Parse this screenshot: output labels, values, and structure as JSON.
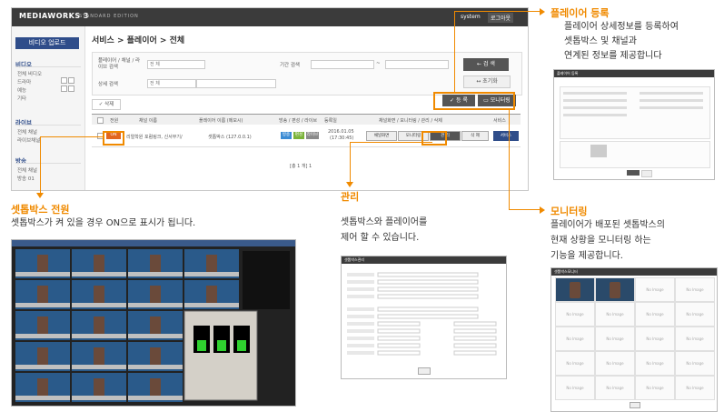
{
  "app": {
    "logo": "MEDIAWORKS 3",
    "logo_sub": "STANDARD EDITION",
    "user": "system",
    "logout": "로그아웃",
    "breadcrumb": "서비스 > 플레이어 > 전체"
  },
  "sidebar": {
    "upload": "비디오 업로드",
    "sections": [
      {
        "title": "비디오",
        "items": [
          "전체 비디오",
          "드라마",
          "예능",
          "기타"
        ]
      },
      {
        "title": "라이브",
        "items": [
          "전체 채널",
          "라이브채널"
        ]
      },
      {
        "title": "방송",
        "items": [
          "전체 채널",
          "방송 01"
        ]
      }
    ]
  },
  "search": {
    "field1_label": "플레이어 / 채널 / 라이브 검색",
    "field1_value": "전 체",
    "period_label": "기간 검색",
    "period_sep": "~",
    "detail_label": "상세 검색",
    "detail_value": "전 체",
    "search_btn": "← 검 색",
    "reset_btn": "↔ 초기화"
  },
  "toolbar": {
    "delete": "✓ 삭제",
    "register": "✓ 등 록",
    "monitor": "▭ 모니터링"
  },
  "table": {
    "headers": [
      "전원",
      "채널 이름",
      "플레이어 이름 (메모시)",
      "방송 / 편성 / 라이브",
      "등록일",
      "채널화면 / 모니터링 / 관리 / 삭제",
      "서비스"
    ],
    "row": {
      "power": "ON",
      "channel": "리얼학원 포럼링크, 신서무기/",
      "player": "셋톱박스 (127.0.0.1)",
      "badges": [
        "방송",
        "편성",
        "라이브"
      ],
      "date": "2016.01.05",
      "time": "(17:30:45)",
      "actions": [
        "채널화면",
        "모니터링",
        "관 리",
        "삭 제"
      ],
      "service": "서비스"
    },
    "pagination": "[총 1 개] 1"
  },
  "callouts": {
    "register": {
      "title": "플레이어 등록",
      "lines": [
        "플레이어 상세정보를 등록하여",
        "셋톱박스 및 채널과",
        "연계된 정보를 제공합니다"
      ]
    },
    "power": {
      "title": "셋톱박스 전원",
      "lines": [
        "셋톱박스가 켜 있을 경우 ON으로 표시가 됩니다."
      ]
    },
    "manage": {
      "title": "관리",
      "lines": [
        "셋톱박스와 플레이어를",
        "제어 할 수 있습니다."
      ]
    },
    "monitor": {
      "title": "모니터링",
      "lines": [
        "플레이어가 배포된 셋톱박스의",
        "현재 상황을 모니터링 하는",
        "기능을 제공합니다."
      ]
    }
  },
  "thumbs": {
    "register_title": "플레이어 등록",
    "manage_title": "셋톱박스관리",
    "monitor_title": "셋톱박스모니터",
    "no_image": "No Image"
  }
}
